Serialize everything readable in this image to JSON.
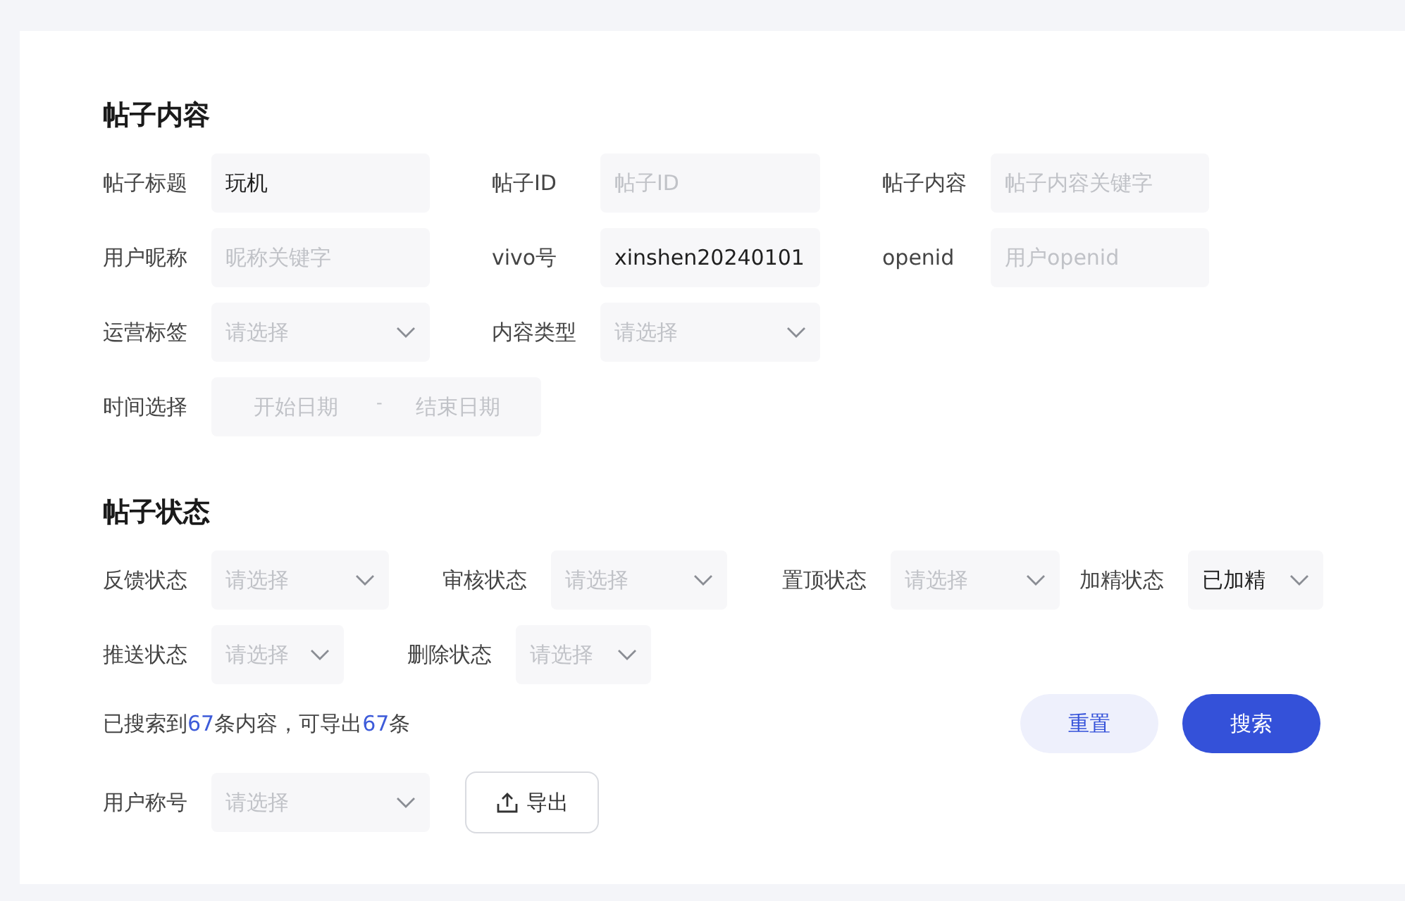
{
  "sections": [
    {
      "title": "帖子内容",
      "rows": [
        [
          {
            "label": "帖子标题",
            "kind": "text",
            "value": "玩机"
          },
          {
            "label": "帖子ID",
            "kind": "text",
            "placeholder": "帖子ID"
          },
          {
            "label": "帖子内容",
            "kind": "text",
            "placeholder": "帖子内容关键字"
          }
        ],
        [
          {
            "label": "用户昵称",
            "kind": "text",
            "placeholder": "昵称关键字"
          },
          {
            "label": "vivo号",
            "kind": "text",
            "value": "xinshen20240101"
          },
          {
            "label": "openid",
            "kind": "text",
            "placeholder": "用户openid"
          }
        ],
        [
          {
            "label": "运营标签",
            "kind": "select",
            "placeholder": "请选择"
          },
          {
            "label": "内容类型",
            "kind": "select",
            "placeholder": "请选择"
          }
        ],
        [
          {
            "label": "时间选择",
            "kind": "daterange",
            "start_placeholder": "开始日期",
            "separator": "-",
            "end_placeholder": "结束日期"
          }
        ]
      ]
    },
    {
      "title": "帖子状态",
      "rows": [
        [
          {
            "label": "反馈状态",
            "kind": "select",
            "placeholder": "请选择"
          },
          {
            "label": "审核状态",
            "kind": "select",
            "placeholder": "请选择"
          },
          {
            "label": "置顶状态",
            "kind": "select",
            "placeholder": "请选择"
          },
          {
            "label": "加精状态",
            "kind": "select",
            "value": "已加精"
          }
        ],
        [
          {
            "label": "推送状态",
            "kind": "select",
            "placeholder": "请选择"
          },
          {
            "label": "删除状态",
            "kind": "select",
            "placeholder": "请选择"
          }
        ]
      ]
    }
  ],
  "summary": [
    {
      "text": "已搜索到",
      "highlight": false
    },
    {
      "text": "67",
      "highlight": true
    },
    {
      "text": "条内容，可导出",
      "highlight": false
    },
    {
      "text": "67",
      "highlight": true
    },
    {
      "text": "条",
      "highlight": false
    }
  ],
  "buttons": [
    {
      "label": "重置",
      "kind": "secondary"
    },
    {
      "label": "搜索",
      "kind": "primary"
    }
  ],
  "user_title": {
    "label": "用户称号",
    "kind": "select",
    "placeholder": "请选择"
  },
  "export_button": {
    "label": "导出"
  }
}
